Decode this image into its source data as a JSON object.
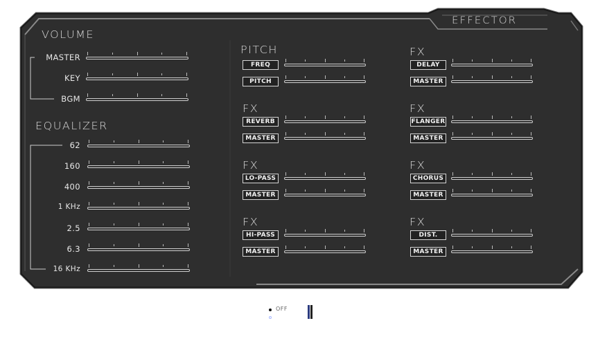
{
  "panel": {
    "title": "EFFECTOR",
    "colors": {
      "panel_bg": "#303030",
      "panel_bg_dark": "#262626",
      "bevel": "#8a8a8a",
      "text": "#e8e8e8"
    }
  },
  "volume": {
    "title": "VOLUME",
    "sliders": [
      {
        "label": "MASTER",
        "value": 0
      },
      {
        "label": "KEY",
        "value": 0
      },
      {
        "label": "BGM",
        "value": 0
      }
    ]
  },
  "equalizer": {
    "title": "EQUALIZER",
    "bands": [
      {
        "label": "62",
        "value": 0
      },
      {
        "label": "160",
        "value": 0
      },
      {
        "label": "400",
        "value": 0
      },
      {
        "label": "1 KHz",
        "value": 0
      },
      {
        "label": "2.5",
        "value": 0
      },
      {
        "label": "6.3",
        "value": 0
      },
      {
        "label": "16 KHz",
        "value": 0
      }
    ]
  },
  "effects": [
    {
      "title": "PITCH",
      "effect_label": "FREQ",
      "master_label": "PITCH"
    },
    {
      "title": "FX",
      "effect_label": "REVERB",
      "master_label": "MASTER"
    },
    {
      "title": "FX",
      "effect_label": "LO-PASS",
      "master_label": "MASTER"
    },
    {
      "title": "FX",
      "effect_label": "HI-PASS",
      "master_label": "MASTER"
    },
    {
      "title": "FX",
      "effect_label": "DELAY",
      "master_label": "MASTER"
    },
    {
      "title": "FX",
      "effect_label": "FLANGER",
      "master_label": "MASTER"
    },
    {
      "title": "FX",
      "effect_label": "CHORUS",
      "master_label": "MASTER"
    },
    {
      "title": "FX",
      "effect_label": "DIST.",
      "master_label": "MASTER"
    }
  ],
  "status": {
    "power_label": "OFF",
    "indicator_color": "#2b3a7e"
  }
}
